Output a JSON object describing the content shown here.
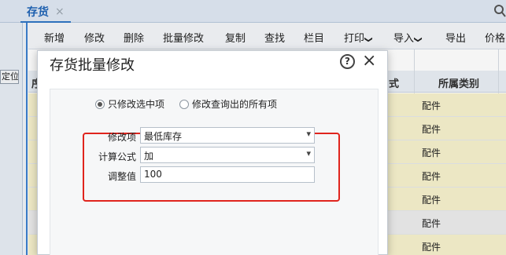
{
  "tabs": [
    {
      "label": "存货",
      "close": "×"
    }
  ],
  "side": {
    "locate_label": "定位"
  },
  "toolbar": {
    "items": [
      {
        "label": "新增"
      },
      {
        "label": "修改"
      },
      {
        "label": "删除"
      },
      {
        "label": "批量修改"
      },
      {
        "label": "复制"
      },
      {
        "label": "查找"
      },
      {
        "label": "栏目"
      },
      {
        "label": "打印",
        "dropdown": true
      },
      {
        "label": "导入",
        "dropdown": true
      },
      {
        "label": "导出"
      },
      {
        "label": "价格"
      }
    ]
  },
  "grid": {
    "columns": [
      "序",
      "式",
      "所属类别"
    ],
    "rows": [
      {
        "category": "配件"
      },
      {
        "category": "配件"
      },
      {
        "category": "配件"
      },
      {
        "category": "配件"
      },
      {
        "category": "配件"
      },
      {
        "category": "配件"
      },
      {
        "category": "配件"
      }
    ]
  },
  "dialog": {
    "title": "存货批量修改",
    "help_icon": "?",
    "close_icon": "×",
    "scope_options": [
      {
        "label": "只修改选中项",
        "selected": true
      },
      {
        "label": "修改查询出的所有项",
        "selected": false
      }
    ],
    "fields": {
      "item": {
        "label": "修改项",
        "value": "最低库存"
      },
      "formula": {
        "label": "计算公式",
        "value": "加"
      },
      "adjust": {
        "label": "调整值",
        "value": "100"
      }
    }
  },
  "colors": {
    "accent": "#2f75c4",
    "highlight_border": "#e0241d",
    "row_yellow": "#f6f1cc"
  }
}
